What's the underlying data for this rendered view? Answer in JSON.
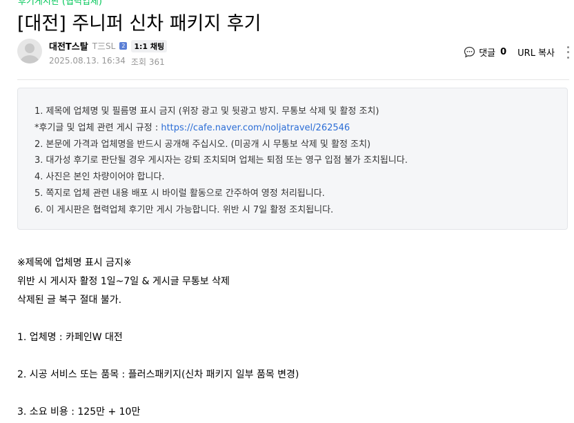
{
  "board_link": "후기게시판 (협력업체)",
  "post": {
    "title": "[대전] 주니퍼 신차 패키지 후기",
    "author": {
      "nickname": "대전T스탈",
      "grade": "T三SL",
      "grade_badge": "2",
      "chat_label": "1:1 채팅"
    },
    "date": "2025.08.13. 16:34",
    "views": "조회 361"
  },
  "actions": {
    "comment_label": "댓글",
    "comment_count": "0",
    "url_copy_label": "URL 복사"
  },
  "notice": {
    "line1": "1. 제목에 업체명 및 필름명 표시 금지 (위장 광고 및 뒷광고 방지. 무통보 삭제 및 활정 조치)",
    "line2_prefix": "*후기글 및 업체 관련 게시 규정 : ",
    "line2_link": "https://cafe.naver.com/noljatravel/262546",
    "line3": "2. 본문에 가격과 업체명을 반드시 공개해 주십시오. (미공개 시 무통보 삭제 및 활정 조치)",
    "line4": "3. 대가성 후기로 판단될 경우 게시자는 강퇴 조치되며 업체는 퇴점 또는 영구 입점 불가 조치됩니다.",
    "line5": "4. 사진은 본인 차량이어야 합니다.",
    "line6": "5. 쪽지로 업체 관련 내용 배포 시 바이럴 활동으로 간주하여 영정 처리됩니다.",
    "line7": "6. 이 게시판은 협력업체 후기만 게시 가능합니다. 위반 시 7일 활정 조치됩니다."
  },
  "body": {
    "warning_title": "※제목에 업체명 표시 금지※",
    "warning_line1": "위반 시 게시자 활정 1일~7일 & 게시글 무통보 삭제",
    "warning_line2": "삭제된 글 복구 절대 불가.",
    "item1": "1. 업체명 :  카페인W 대전",
    "item2": "2. 시공 서비스 또는 품목 :  플러스패키지(신차 패키지 일부 품목 변경)",
    "item3": "3. 소요 비용 :  125만 + 10만"
  }
}
